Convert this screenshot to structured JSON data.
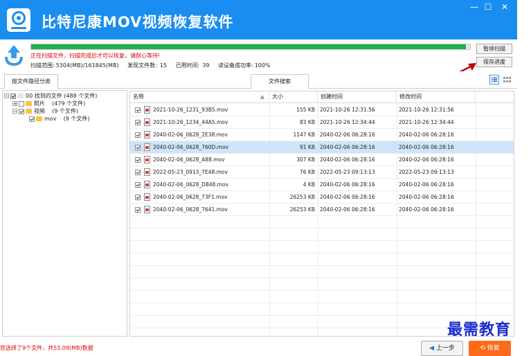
{
  "app": {
    "title": "比特尼康MOV视频恢复软件",
    "window_controls": {
      "minimize": "—",
      "maximize": "☐",
      "close": "✕"
    }
  },
  "scan": {
    "progress_percent": 99,
    "message": "正在扫描文件，扫描完成后才可以恢复，请耐心等待!",
    "range_label": "扫描范围:",
    "range_value": "5304(MB)/161845(MB)",
    "found_label": "发现文件数:",
    "found_value": "15",
    "time_label": "已用时间:",
    "time_value": "39",
    "read_label": "读设备成功率:",
    "read_value": "100%",
    "pause_label": "暂停扫描",
    "save_label": "保存进度"
  },
  "tabs": [
    {
      "label": "按文件路径分类",
      "active": true
    },
    {
      "label": "文件搜索",
      "active": false
    }
  ],
  "view_icons": [
    "list-view-icon",
    "grid-view-icon"
  ],
  "tree": {
    "root": {
      "label": "00 找到的文件",
      "count": "(488 个文件)"
    },
    "photos": {
      "label": "照片",
      "count": "(479 个文件)"
    },
    "video": {
      "label": "视频",
      "count": "(9 个文件)"
    },
    "mov": {
      "label": "mov",
      "count": "(9 个文件)"
    }
  },
  "table": {
    "columns": [
      "名称",
      "大小",
      "创建时间",
      "修改时间"
    ],
    "rows": [
      {
        "name": "2021-10-26_1231_93B5.mov",
        "size": "155 KB",
        "created": "2021-10-26  12:31:56",
        "modified": "2021-10-26  12:31:56"
      },
      {
        "name": "2021-10-26_1234_44A5.mov",
        "size": "83 KB",
        "created": "2021-10-26  12:34:44",
        "modified": "2021-10-26  12:34:44"
      },
      {
        "name": "2040-02-06_0628_2E38.mov",
        "size": "1147 KB",
        "created": "2040-02-06  06:28:16",
        "modified": "2040-02-06  06:28:16"
      },
      {
        "name": "2040-02-06_0628_760D.mov",
        "size": "91 KB",
        "created": "2040-02-06  06:28:16",
        "modified": "2040-02-06  06:28:16",
        "selected": true
      },
      {
        "name": "2040-02-06_0628_A88.mov",
        "size": "307 KB",
        "created": "2040-02-06  06:28:16",
        "modified": "2040-02-06  06:28:16"
      },
      {
        "name": "2022-05-23_0913_7E48.mov",
        "size": "76 KB",
        "created": "2022-05-23  09:13:13",
        "modified": "2022-05-23  09:13:13"
      },
      {
        "name": "2040-02-06_0628_D848.mov",
        "size": "4 KB",
        "created": "2040-02-06  06:28:16",
        "modified": "2040-02-06  06:28:16"
      },
      {
        "name": "2040-02-06_0628_73F1.mov",
        "size": "26253 KB",
        "created": "2040-02-06  06:28:16",
        "modified": "2040-02-06  06:28:16"
      },
      {
        "name": "2040-02-06_0628_7641.mov",
        "size": "26253 KB",
        "created": "2040-02-06  06:28:16",
        "modified": "2040-02-06  06:28:16"
      }
    ]
  },
  "footer": {
    "selection_msg": "您选择了9个文件，共53.09(MB)数据",
    "prev_label": "上一步",
    "recover_label": "恢复"
  },
  "watermark": "最需教育",
  "colors": {
    "title_bar": "#1a8ef0",
    "progress": "#22b14c",
    "warning_text": "#e00000",
    "recover_button": "#ff6a1a",
    "selected_row": "#cde5fb"
  }
}
